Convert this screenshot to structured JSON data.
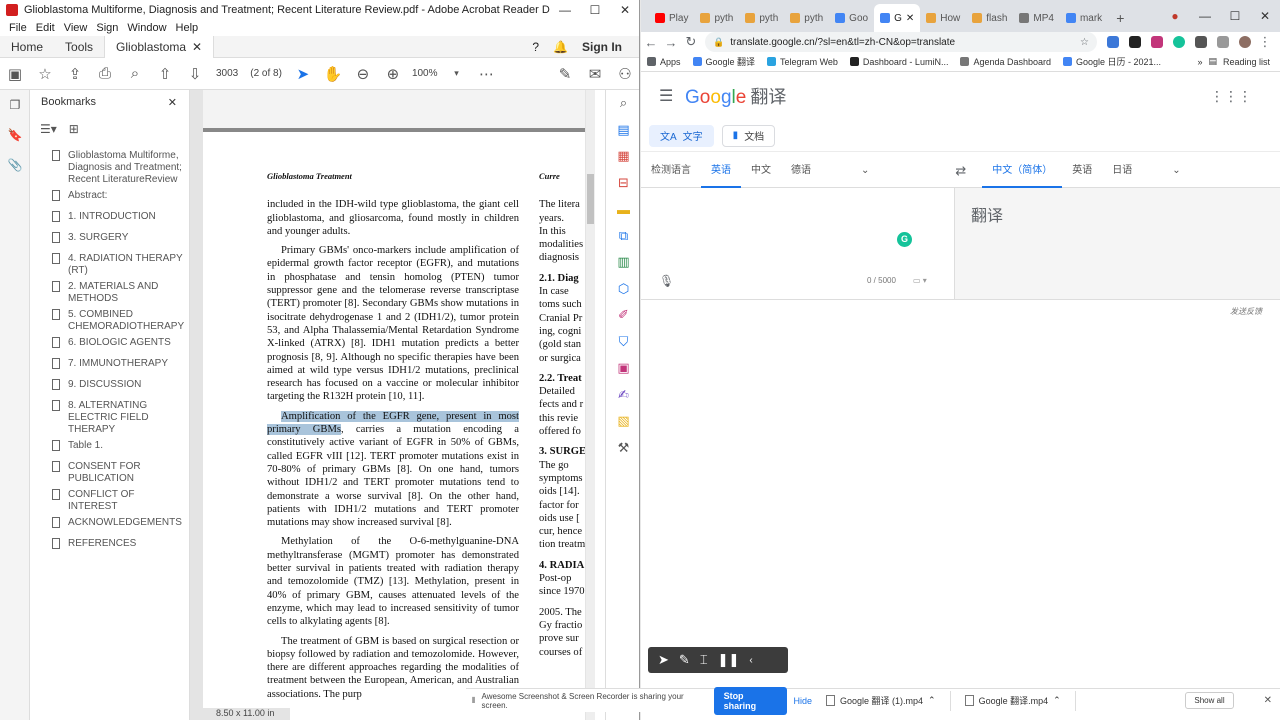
{
  "acrobat": {
    "window_title": "Glioblastoma Multiforme, Diagnosis and Treatment; Recent Literature Review.pdf - Adobe Acrobat Reader DC (32-bit)",
    "menus": [
      "File",
      "Edit",
      "View",
      "Sign",
      "Window",
      "Help"
    ],
    "tabs": {
      "home": "Home",
      "tools": "Tools",
      "doc": "Glioblastoma Multif...",
      "signin": "Sign In"
    },
    "toolbar": {
      "page_number": "3003",
      "page_of": "(2 of 8)",
      "zoom": "100%"
    },
    "bookmarks_title": "Bookmarks",
    "bookmarks": [
      "Glioblastoma Multiforme, Diagnosis and Treatment; Recent LiteratureReview",
      "Abstract:",
      "1. INTRODUCTION",
      "3. SURGERY",
      "4. RADIATION THERAPY (RT)",
      "2. MATERIALS AND METHODS",
      "5. COMBINED CHEMORADIOTHERAPY",
      "6. BIOLOGIC AGENTS",
      "7. IMMUNOTHERAPY",
      "9. DISCUSSION",
      "8. ALTERNATING ELECTRIC FIELD THERAPY",
      "Table 1.",
      "CONSENT FOR PUBLICATION",
      "CONFLICT OF INTEREST",
      "ACKNOWLEDGEMENTS",
      "REFERENCES"
    ],
    "page_size": "8.50 x 11.00 in",
    "doc": {
      "running_head_left": "Glioblastoma Treatment",
      "running_head_right": "Curre",
      "p1": "included in the IDH-wild type glioblastoma, the giant cell glioblastoma, and gliosarcoma, found mostly in children and younger adults.",
      "p2": "Primary GBMs' onco-markers include amplification of epidermal growth factor receptor (EGFR), and mutations in phosphatase and tensin homolog (PTEN) tumor suppressor gene and the telomerase reverse transcriptase (TERT) promoter [8]. Secondary GBMs show mutations in isocitrate dehydrogenase 1 and 2 (IDH1/2), tumor protein 53, and Alpha Thalassemia/Mental Retardation Syndrome X-linked (ATRX) [8]. IDH1 mutation predicts a better prognosis [8, 9]. Although no specific therapies have been aimed at wild type versus IDH1/2 mutations, preclinical research has focused on a vaccine or molecular inhibitor targeting the R132H protein [10, 11].",
      "p3_highlight": "Amplification of the EGFR gene, present in most primary GBMs",
      "p3_rest": ", carries a mutation encoding a constitutively active variant of EGFR in 50% of GBMs, called EGFR vIII [12]. TERT promoter mutations exist in 70-80% of primary GBMs [8]. On one hand, tumors without IDH1/2 and TERT promoter mutations tend to demonstrate a worse survival [8]. On the other hand, patients with IDH1/2 mutations and TERT promoter mutations may show increased survival [8].",
      "p4": "Methylation of the O-6-methylguanine-DNA methyltransferase (MGMT) promoter has demonstrated better survival in patients treated with radiation therapy and temozolomide (TMZ) [13]. Methylation, present in 40% of primary GBM, causes attenuated levels of the enzyme, which may lead to increased sensitivity of tumor cells to alkylating agents [8].",
      "p5": "The treatment of GBM is based on surgical resection or biopsy followed by radiation and temozolomide. However, there are different approaches regarding the modalities of treatment between the European, American, and Australian associations. The purp",
      "right_col": [
        "The litera",
        "years.",
        "In this",
        "modalities",
        "diagnosis",
        "2.1. Diag",
        "In case",
        "toms such",
        "Cranial Pr",
        "ing, cogni",
        "(gold stan",
        "or surgica",
        "2.2. Treat",
        "Detailed",
        "fects and r",
        "this revie",
        "offered fo",
        "3. SURGE",
        "The go",
        "symptoms",
        "oids [14].",
        "factor for",
        "oids use [",
        "cur, hence",
        "tion treatm",
        "4. RADIA",
        "Post-op",
        "since 1970",
        "2005. The",
        "Gy fractio",
        "prove sur",
        "courses of"
      ]
    }
  },
  "chrome": {
    "tabs": [
      {
        "label": "Play",
        "color": "#ff0000"
      },
      {
        "label": "pyth",
        "color": "#e8a33d"
      },
      {
        "label": "pyth",
        "color": "#e8a33d"
      },
      {
        "label": "pyth",
        "color": "#e8a33d"
      },
      {
        "label": "Goo",
        "color": "#4285f4"
      },
      {
        "label": "G",
        "color": "#4285f4",
        "active": true
      },
      {
        "label": "How",
        "color": "#e8a33d"
      },
      {
        "label": "flash",
        "color": "#e8a33d"
      },
      {
        "label": "MP4",
        "color": "#777777"
      },
      {
        "label": "mark",
        "color": "#4285f4"
      }
    ],
    "url": "translate.google.cn/?sl=en&tl=zh-CN&op=translate",
    "bookmarks": [
      {
        "label": "Apps",
        "color": "#5f6368"
      },
      {
        "label": "Google 翻译",
        "color": "#4285f4"
      },
      {
        "label": "Telegram Web",
        "color": "#2aa3e0"
      },
      {
        "label": "Dashboard - LumiN...",
        "color": "#222222"
      },
      {
        "label": "Agenda Dashboard",
        "color": "#777777"
      },
      {
        "label": "Google 日历 - 2021...",
        "color": "#4285f4"
      }
    ],
    "reading_list": "Reading list",
    "translate": {
      "logo_letters": [
        "G",
        "o",
        "o",
        "g",
        "l",
        "e"
      ],
      "product": "翻译",
      "mode_text": "文字",
      "mode_docs": "文档",
      "source_langs": [
        "检测语言",
        "英语",
        "中文",
        "德语"
      ],
      "target_langs": [
        "中文（简体）",
        "英语",
        "日语"
      ],
      "char_count": "0 / 5000",
      "output_placeholder": "翻译",
      "feedback": "发送反馈"
    }
  },
  "overlays": {
    "share_message": "Awesome Screenshot & Screen Recorder is sharing your screen.",
    "stop_sharing": "Stop sharing",
    "hide": "Hide",
    "downloads": [
      "Google 翻译 (1).mp4",
      "Google 翻译.mp4"
    ],
    "show_all": "Show all"
  },
  "colors": {
    "accent_blue": "#1a73e8",
    "pdf_highlight": "#a9c4db",
    "acrobat_red": "#d21f1f"
  }
}
